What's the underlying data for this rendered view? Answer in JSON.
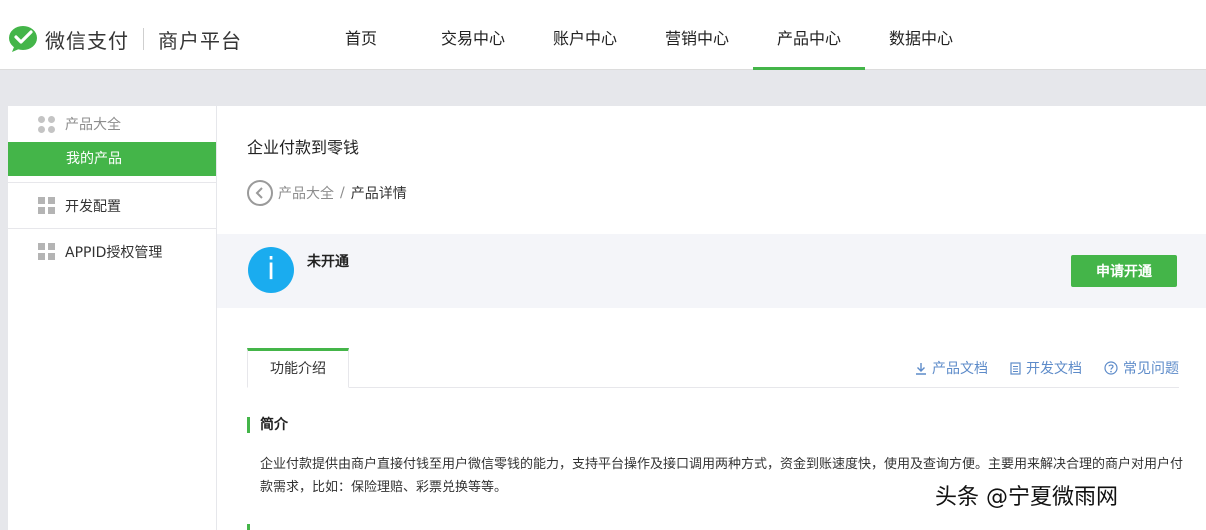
{
  "brand": {
    "name": "微信支付",
    "sub": "商户平台",
    "logo_color": "#44b549"
  },
  "nav": {
    "items": [
      {
        "label": "首页"
      },
      {
        "label": "交易中心"
      },
      {
        "label": "账户中心"
      },
      {
        "label": "营销中心"
      },
      {
        "label": "产品中心",
        "active": true
      },
      {
        "label": "数据中心"
      }
    ]
  },
  "sidebar": {
    "group_label": "产品大全",
    "sub_active": "我的产品",
    "items": [
      {
        "label": "开发配置",
        "icon": "grid-icon"
      },
      {
        "label": "APPID授权管理",
        "icon": "grid-icon"
      }
    ]
  },
  "main": {
    "title": "企业付款到零钱",
    "breadcrumb": {
      "parent": "产品大全",
      "separator": "/",
      "current": "产品详情"
    },
    "status": {
      "text": "未开通",
      "icon": "info-icon",
      "icon_glyph": "i"
    },
    "apply_button": "申请开通",
    "tab": "功能介绍",
    "doc_links": [
      "产品文档",
      "开发文档",
      "常见问题"
    ],
    "section_title": "简介",
    "description": "企业付款提供由商户直接付钱至用户微信零钱的能力，支持平台操作及接口调用两种方式，资金到账速度快，使用及查询方便。主要用来解决合理的商户对用户付款需求，比如：保险理赔、彩票兑换等等。"
  },
  "watermark": "头条 @宁夏微雨网",
  "colors": {
    "accent": "#44b549",
    "info": "#1aacef",
    "link": "#5d8bc9"
  }
}
